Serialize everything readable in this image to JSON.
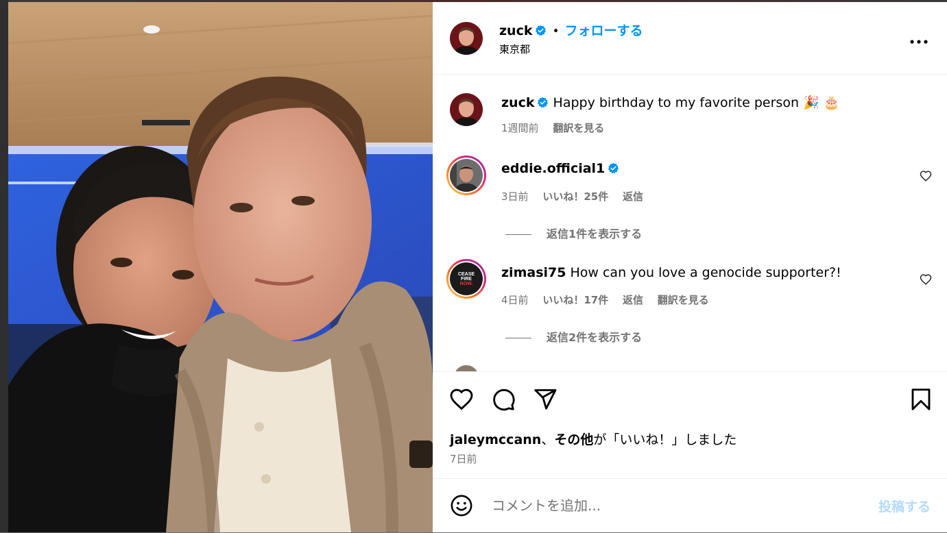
{
  "post": {
    "author": "zuck",
    "follow_label": "フォローする",
    "separator": "•",
    "location": "東京都"
  },
  "caption": {
    "author": "zuck",
    "text": "Happy birthday to my favorite person 🎉 🎂",
    "time": "1週間前",
    "translate": "翻訳を見る"
  },
  "comments": [
    {
      "author": "eddie.official1",
      "text": "",
      "time": "3日前",
      "likes": "いいね！25件",
      "reply": "返信",
      "translate": "",
      "view_replies": "返信1件を表示する"
    },
    {
      "author": "zimasi75",
      "text": "How can you love a genocide supporter?!",
      "time": "4日前",
      "likes": "いいね！17件",
      "reply": "返信",
      "translate": "翻訳を見る",
      "view_replies": "返信2件を表示する",
      "avatar_lines": [
        "CEASE",
        "FIRE",
        "NOW."
      ]
    }
  ],
  "likes_summary": {
    "user": "jaleymccann",
    "sep": "、",
    "others": "その他",
    "suffix": "が「いいね！」しました",
    "date": "7日前"
  },
  "compose": {
    "placeholder": "コメントを追加...",
    "post_label": "投稿する"
  },
  "icons": {
    "verified": "verified-badge-icon",
    "more": "more-options-icon",
    "like": "heart-icon",
    "comment": "comment-bubble-icon",
    "share": "paper-plane-icon",
    "save": "bookmark-icon",
    "emoji": "emoji-smiley-icon"
  },
  "colors": {
    "accent": "#0095f6",
    "secondary_text": "#737373",
    "verified": "#0095f6",
    "post_disabled": "#b3dbff"
  }
}
